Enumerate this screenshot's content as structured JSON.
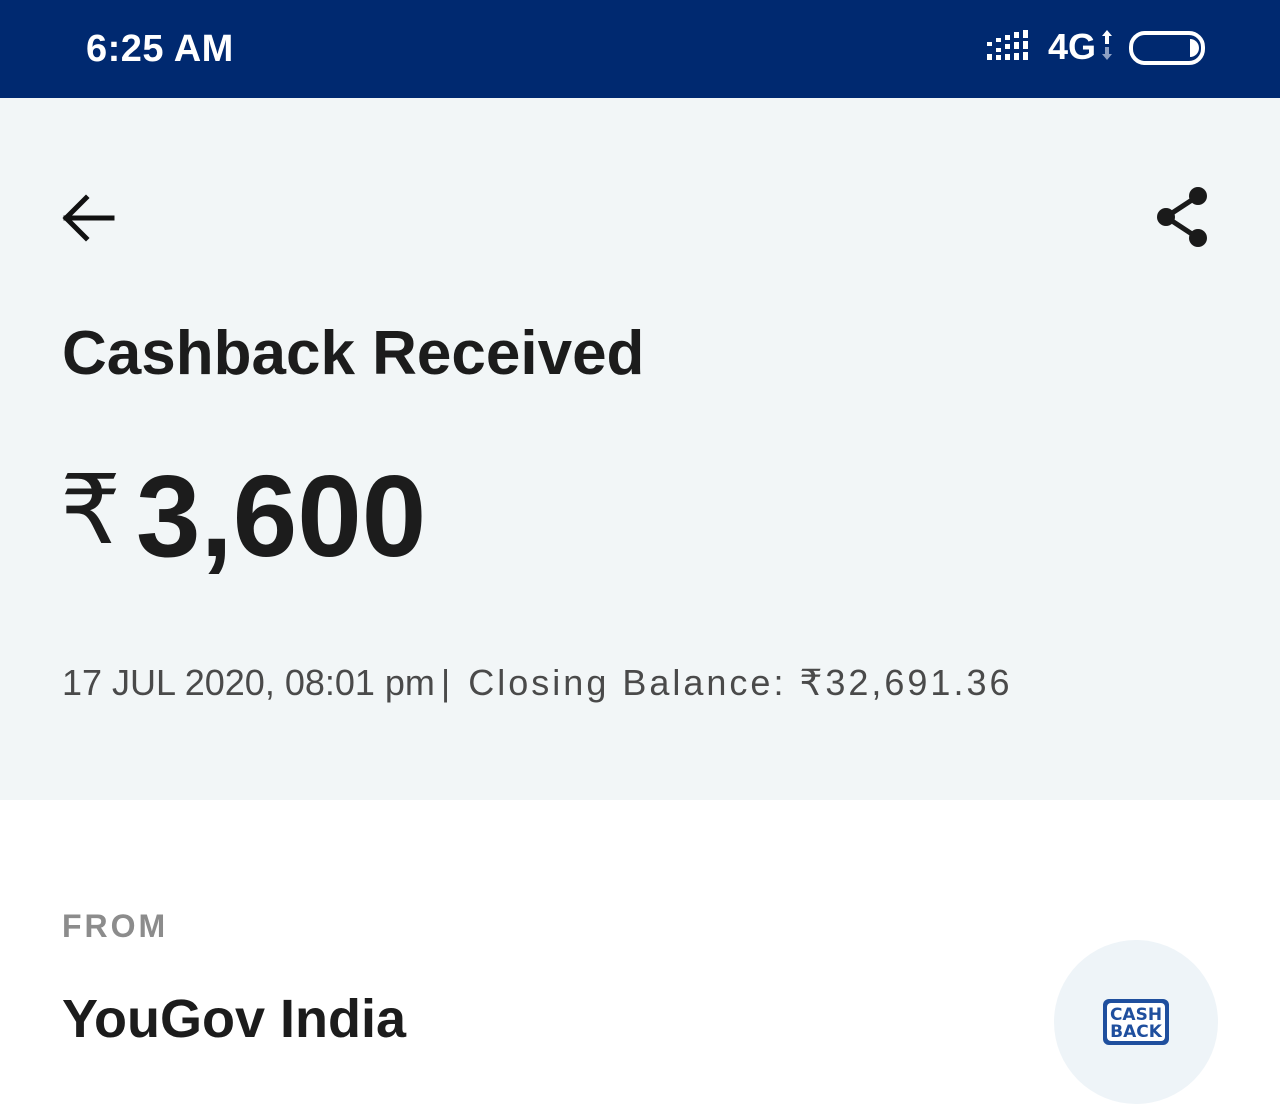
{
  "status_bar": {
    "time": "6:25 AM",
    "network": "4G",
    "signal_icon": "signal-bars-icon",
    "battery_icon": "battery-icon",
    "background_color": "#002970"
  },
  "header": {
    "back_icon": "arrow-left-icon",
    "share_icon": "share-icon",
    "title": "Cashback Received",
    "currency_symbol": "₹",
    "amount": "3,600",
    "datetime": "17 JUL 2020, 08:01 pm",
    "separator": "|",
    "closing_balance": "Closing Balance: ₹32,691.36",
    "background_color": "#f2f6f7"
  },
  "from_section": {
    "label": "FROM",
    "name": "YouGov India",
    "logo_text": "CASH BACK",
    "logo_icon": "cashback-logo-icon"
  }
}
